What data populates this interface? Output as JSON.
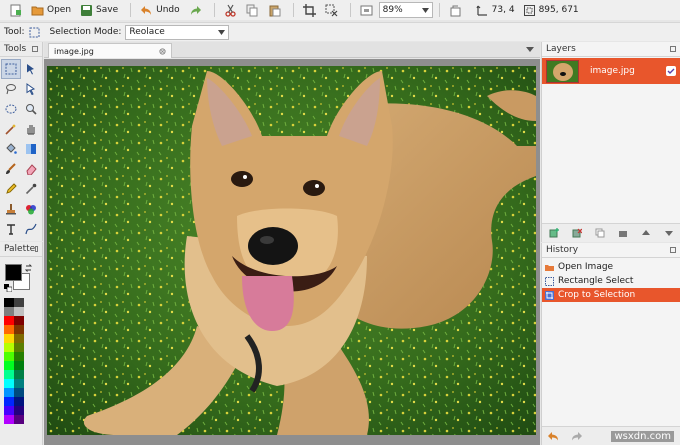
{
  "toolbar": {
    "new_icon": "new-image-icon",
    "open_label": "Open",
    "save_label": "Save",
    "undo_label": "Undo",
    "zoom_value": "89%",
    "cursor_position": "73, 4",
    "image_size": "895, 671"
  },
  "options": {
    "tool_label": "Tool:",
    "selection_mode_label": "Selection Mode:",
    "selection_mode_value": "Reolace"
  },
  "tools_panel": {
    "title": "Tools"
  },
  "palette_panel": {
    "title": "Palette"
  },
  "document": {
    "tab_label": "image.jpg"
  },
  "layers_panel": {
    "title": "Layers",
    "layers": [
      {
        "name": "image.jpg",
        "visible": true
      }
    ]
  },
  "history_panel": {
    "title": "History",
    "items": [
      {
        "label": "Open Image",
        "selected": false
      },
      {
        "label": "Rectangle Select",
        "selected": false
      },
      {
        "label": "Crop to Selection",
        "selected": true
      }
    ]
  },
  "watermark": "wsxdn.com",
  "colors": {
    "accent": "#e8562c",
    "selected_tool": "#cbd6e6"
  }
}
